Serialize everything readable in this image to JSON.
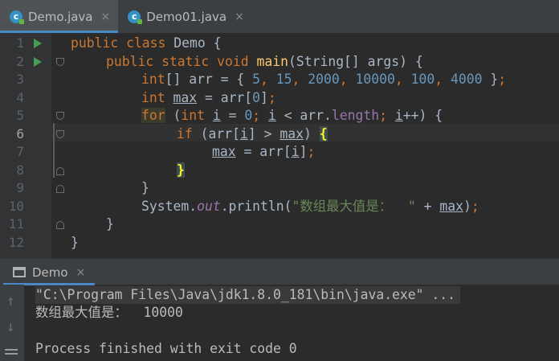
{
  "tabs": [
    {
      "label": "Demo.java",
      "active": true,
      "icon": "java-class-icon"
    },
    {
      "label": "Demo01.java",
      "active": false,
      "icon": "java-class-icon"
    }
  ],
  "tab_close_glyph": "×",
  "line_numbers": [
    "1",
    "2",
    "3",
    "4",
    "5",
    "6",
    "7",
    "8",
    "9",
    "10",
    "11",
    "12"
  ],
  "code": {
    "l1": {
      "a": "public class ",
      "b": "Demo {"
    },
    "l2": {
      "a": "public static void ",
      "fn": "main",
      "b": "(String[] args) {"
    },
    "l3": {
      "kw": "int",
      "a": "[] arr = { ",
      "n1": "5",
      "c1": ", ",
      "n2": "15",
      "c2": ", ",
      "n3": "2000",
      "c3": ", ",
      "n4": "10000",
      "c4": ", ",
      "n5": "100",
      "c5": ", ",
      "n6": "4000",
      "b": " }",
      "semi": ";"
    },
    "l4": {
      "kw": "int ",
      "v": "max",
      "a": " = arr[",
      "n": "0",
      "b": "]",
      "semi": ";"
    },
    "l5": {
      "kw": "for",
      "a": " (",
      "kw2": "int ",
      "v": "i",
      "b": " = ",
      "n": "0",
      "semi1": "; ",
      "v2": "i",
      "c": " < arr.",
      "fld": "length",
      "semi2": "; ",
      "v3": "i",
      "d": "++) {"
    },
    "l6": {
      "kw": "if",
      "a": " (arr[",
      "v": "i",
      "b": "] > ",
      "v2": "max",
      "c": ") ",
      "brace": "{"
    },
    "l7": {
      "v": "max",
      "a": " = arr[",
      "v2": "i",
      "b": "]",
      "semi": ";"
    },
    "l8": {
      "brace": "}"
    },
    "l9": {
      "a": "}"
    },
    "l10": {
      "a": "System.",
      "out": "out",
      "b": ".println(",
      "str": "\"数组最大值是：  \"",
      "c": " + ",
      "v": "max",
      "d": ")",
      "semi": ";"
    },
    "l11": {
      "a": "}"
    },
    "l12": {
      "a": "}"
    }
  },
  "run_panel": {
    "tab_label": "Demo",
    "command": "\"C:\\Program Files\\Java\\jdk1.8.0_181\\bin\\java.exe\" ...",
    "output": "数组最大值是：  10000",
    "exit": "Process finished with exit code 0"
  },
  "colors": {
    "keyword": "#cc7832",
    "number": "#6897bb",
    "function": "#ffc66d",
    "string": "#6a8759",
    "field": "#9876aa",
    "accent": "#4a88c7",
    "run_green": "#499c54"
  }
}
